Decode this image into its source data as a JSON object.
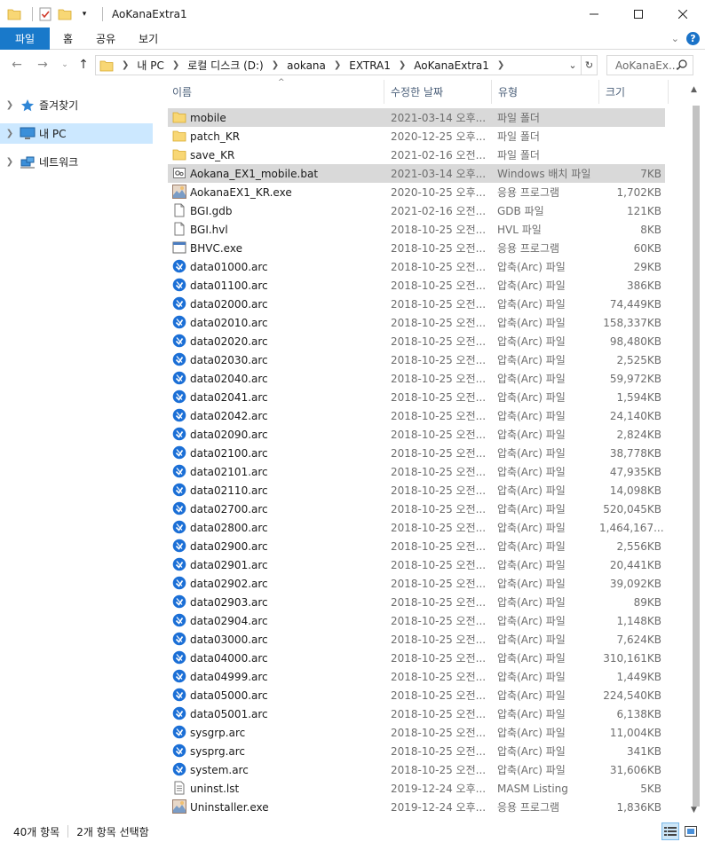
{
  "window": {
    "title": "AoKanaExtra1"
  },
  "ribbon": {
    "tabs": [
      "파일",
      "홈",
      "공유",
      "보기"
    ]
  },
  "address": {
    "crumbs": [
      "내 PC",
      "로컬 디스크 (D:)",
      "aokana",
      "EXTRA1",
      "AoKanaExtra1"
    ],
    "search_placeholder": "AoKanaEx..."
  },
  "nav": {
    "items": [
      {
        "label": "즐겨찾기",
        "icon": "star-icon"
      },
      {
        "label": "내 PC",
        "icon": "pc-icon"
      },
      {
        "label": "네트워크",
        "icon": "network-icon"
      }
    ]
  },
  "columns": {
    "name": "이름",
    "date": "수정한 날짜",
    "type": "유형",
    "size": "크기"
  },
  "files": [
    {
      "name": "mobile",
      "date": "2021-03-14 오후...",
      "type": "파일 폴더",
      "size": "",
      "icon": "folder-icon",
      "selected": true
    },
    {
      "name": "patch_KR",
      "date": "2020-12-25 오후...",
      "type": "파일 폴더",
      "size": "",
      "icon": "folder-icon",
      "selected": false
    },
    {
      "name": "save_KR",
      "date": "2021-02-16 오전...",
      "type": "파일 폴더",
      "size": "",
      "icon": "folder-icon",
      "selected": false
    },
    {
      "name": "Aokana_EX1_mobile.bat",
      "date": "2021-03-14 오후...",
      "type": "Windows 배치 파일",
      "size": "7KB",
      "icon": "batch-file-icon",
      "selected": true
    },
    {
      "name": "AokanaEX1_KR.exe",
      "date": "2020-10-25 오후...",
      "type": "응용 프로그램",
      "size": "1,702KB",
      "icon": "app-image-icon",
      "selected": false
    },
    {
      "name": "BGI.gdb",
      "date": "2021-02-16 오전...",
      "type": "GDB 파일",
      "size": "121KB",
      "icon": "blank-file-icon",
      "selected": false
    },
    {
      "name": "BGI.hvl",
      "date": "2018-10-25 오전...",
      "type": "HVL 파일",
      "size": "8KB",
      "icon": "blank-file-icon",
      "selected": false
    },
    {
      "name": "BHVC.exe",
      "date": "2018-10-25 오전...",
      "type": "응용 프로그램",
      "size": "60KB",
      "icon": "exe-icon",
      "selected": false
    },
    {
      "name": "data01000.arc",
      "date": "2018-10-25 오전...",
      "type": "압축(Arc) 파일",
      "size": "29KB",
      "icon": "arc-icon",
      "selected": false
    },
    {
      "name": "data01100.arc",
      "date": "2018-10-25 오전...",
      "type": "압축(Arc) 파일",
      "size": "386KB",
      "icon": "arc-icon",
      "selected": false
    },
    {
      "name": "data02000.arc",
      "date": "2018-10-25 오전...",
      "type": "압축(Arc) 파일",
      "size": "74,449KB",
      "icon": "arc-icon",
      "selected": false
    },
    {
      "name": "data02010.arc",
      "date": "2018-10-25 오전...",
      "type": "압축(Arc) 파일",
      "size": "158,337KB",
      "icon": "arc-icon",
      "selected": false
    },
    {
      "name": "data02020.arc",
      "date": "2018-10-25 오전...",
      "type": "압축(Arc) 파일",
      "size": "98,480KB",
      "icon": "arc-icon",
      "selected": false
    },
    {
      "name": "data02030.arc",
      "date": "2018-10-25 오전...",
      "type": "압축(Arc) 파일",
      "size": "2,525KB",
      "icon": "arc-icon",
      "selected": false
    },
    {
      "name": "data02040.arc",
      "date": "2018-10-25 오전...",
      "type": "압축(Arc) 파일",
      "size": "59,972KB",
      "icon": "arc-icon",
      "selected": false
    },
    {
      "name": "data02041.arc",
      "date": "2018-10-25 오전...",
      "type": "압축(Arc) 파일",
      "size": "1,594KB",
      "icon": "arc-icon",
      "selected": false
    },
    {
      "name": "data02042.arc",
      "date": "2018-10-25 오전...",
      "type": "압축(Arc) 파일",
      "size": "24,140KB",
      "icon": "arc-icon",
      "selected": false
    },
    {
      "name": "data02090.arc",
      "date": "2018-10-25 오전...",
      "type": "압축(Arc) 파일",
      "size": "2,824KB",
      "icon": "arc-icon",
      "selected": false
    },
    {
      "name": "data02100.arc",
      "date": "2018-10-25 오전...",
      "type": "압축(Arc) 파일",
      "size": "38,778KB",
      "icon": "arc-icon",
      "selected": false
    },
    {
      "name": "data02101.arc",
      "date": "2018-10-25 오전...",
      "type": "압축(Arc) 파일",
      "size": "47,935KB",
      "icon": "arc-icon",
      "selected": false
    },
    {
      "name": "data02110.arc",
      "date": "2018-10-25 오전...",
      "type": "압축(Arc) 파일",
      "size": "14,098KB",
      "icon": "arc-icon",
      "selected": false
    },
    {
      "name": "data02700.arc",
      "date": "2018-10-25 오전...",
      "type": "압축(Arc) 파일",
      "size": "520,045KB",
      "icon": "arc-icon",
      "selected": false
    },
    {
      "name": "data02800.arc",
      "date": "2018-10-25 오전...",
      "type": "압축(Arc) 파일",
      "size": "1,464,167...",
      "icon": "arc-icon",
      "selected": false
    },
    {
      "name": "data02900.arc",
      "date": "2018-10-25 오전...",
      "type": "압축(Arc) 파일",
      "size": "2,556KB",
      "icon": "arc-icon",
      "selected": false
    },
    {
      "name": "data02901.arc",
      "date": "2018-10-25 오전...",
      "type": "압축(Arc) 파일",
      "size": "20,441KB",
      "icon": "arc-icon",
      "selected": false
    },
    {
      "name": "data02902.arc",
      "date": "2018-10-25 오전...",
      "type": "압축(Arc) 파일",
      "size": "39,092KB",
      "icon": "arc-icon",
      "selected": false
    },
    {
      "name": "data02903.arc",
      "date": "2018-10-25 오전...",
      "type": "압축(Arc) 파일",
      "size": "89KB",
      "icon": "arc-icon",
      "selected": false
    },
    {
      "name": "data02904.arc",
      "date": "2018-10-25 오전...",
      "type": "압축(Arc) 파일",
      "size": "1,148KB",
      "icon": "arc-icon",
      "selected": false
    },
    {
      "name": "data03000.arc",
      "date": "2018-10-25 오전...",
      "type": "압축(Arc) 파일",
      "size": "7,624KB",
      "icon": "arc-icon",
      "selected": false
    },
    {
      "name": "data04000.arc",
      "date": "2018-10-25 오전...",
      "type": "압축(Arc) 파일",
      "size": "310,161KB",
      "icon": "arc-icon",
      "selected": false
    },
    {
      "name": "data04999.arc",
      "date": "2018-10-25 오전...",
      "type": "압축(Arc) 파일",
      "size": "1,449KB",
      "icon": "arc-icon",
      "selected": false
    },
    {
      "name": "data05000.arc",
      "date": "2018-10-25 오전...",
      "type": "압축(Arc) 파일",
      "size": "224,540KB",
      "icon": "arc-icon",
      "selected": false
    },
    {
      "name": "data05001.arc",
      "date": "2018-10-25 오전...",
      "type": "압축(Arc) 파일",
      "size": "6,138KB",
      "icon": "arc-icon",
      "selected": false
    },
    {
      "name": "sysgrp.arc",
      "date": "2018-10-25 오전...",
      "type": "압축(Arc) 파일",
      "size": "11,004KB",
      "icon": "arc-icon",
      "selected": false
    },
    {
      "name": "sysprg.arc",
      "date": "2018-10-25 오전...",
      "type": "압축(Arc) 파일",
      "size": "341KB",
      "icon": "arc-icon",
      "selected": false
    },
    {
      "name": "system.arc",
      "date": "2018-10-25 오전...",
      "type": "압축(Arc) 파일",
      "size": "31,606KB",
      "icon": "arc-icon",
      "selected": false
    },
    {
      "name": "uninst.lst",
      "date": "2019-12-24 오후...",
      "type": "MASM Listing",
      "size": "5KB",
      "icon": "text-file-icon",
      "selected": false
    },
    {
      "name": "Uninstaller.exe",
      "date": "2019-12-24 오후...",
      "type": "응용 프로그램",
      "size": "1,836KB",
      "icon": "app-image-icon",
      "selected": false
    }
  ],
  "status": {
    "count": "40개 항목",
    "selection": "2개 항목 선택함"
  },
  "colors": {
    "accent": "#1979ca",
    "selection": "#d9d9d9",
    "nav_selected": "#cce8ff",
    "folder": "#f8d775",
    "arc_blue": "#1b6fd6"
  }
}
